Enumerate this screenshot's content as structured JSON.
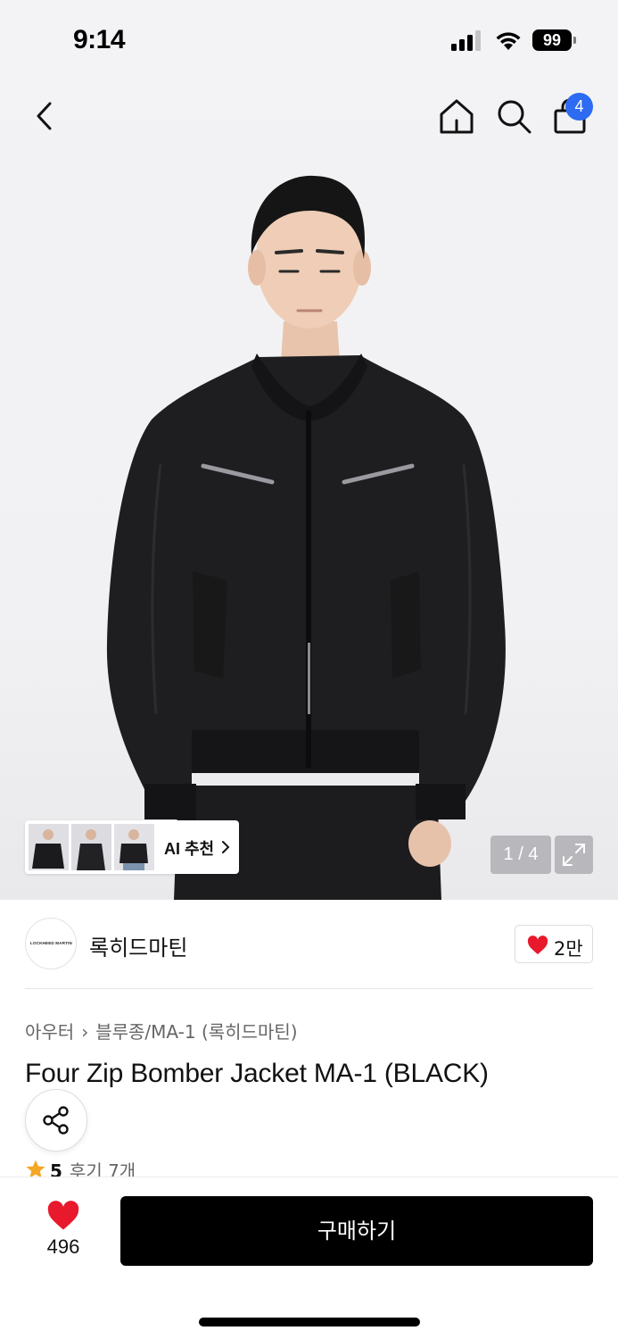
{
  "status_bar": {
    "time": "9:14",
    "battery": "99"
  },
  "nav": {
    "cart_count": "4",
    "icons": [
      "back-icon",
      "home-icon",
      "search-icon",
      "cart-icon"
    ]
  },
  "gallery": {
    "ai_label": "AI 추천",
    "counter": "1 / 4"
  },
  "brand": {
    "name": "록히드마틴",
    "logo_text": "LOCKHEED MARTIN",
    "like_count": "2만"
  },
  "breadcrumb": {
    "category": "아우터",
    "subcategory": "블루종/MA-1 (록히드마틴)"
  },
  "product": {
    "title": "Four Zip Bomber Jacket MA-1 (BLACK)"
  },
  "rating": {
    "score": "5",
    "reviews": "후기 7개"
  },
  "bottom": {
    "wish_count": "496",
    "buy_label": "구매하기"
  },
  "colors": {
    "accent_blue": "#2c6bf2",
    "heart_red": "#e8192c",
    "star_orange": "#f5a623",
    "primary_black": "#000000"
  }
}
